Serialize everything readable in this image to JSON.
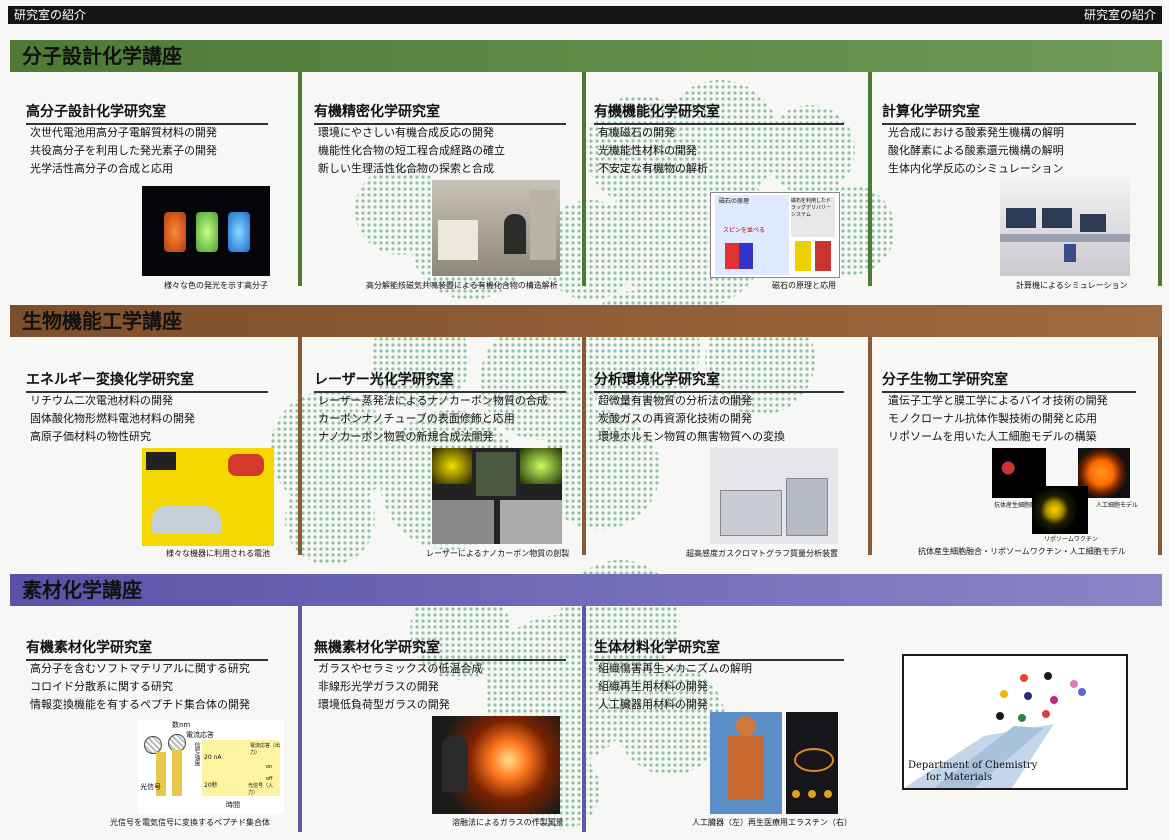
{
  "header": {
    "left": "研究室の紹介",
    "right": "研究室の紹介"
  },
  "sections": [
    {
      "title": "分子設計化学講座",
      "color": "#587d3a",
      "labs": [
        {
          "title": "高分子設計化学研究室",
          "items": [
            "次世代電池用高分子電解質材料の開発",
            "共役高分子を利用した発光素子の開発",
            "光学活性高分子の合成と応用"
          ],
          "caption": "様々な色の発光を示す高分子"
        },
        {
          "title": "有機精密化学研究室",
          "items": [
            "環境にやさしい有機合成反応の開発",
            "機能性化合物の短工程合成経路の確立",
            "新しい生理活性化合物の探索と合成"
          ],
          "caption": "高分解能核磁気共鳴装置による有機化合物の構造解析"
        },
        {
          "title": "有機機能化学研究室",
          "items": [
            "有機磁石の開発",
            "光機能性材料の開発",
            "不安定な有機物の解析"
          ],
          "caption": "磁石の原理と応用"
        },
        {
          "title": "計算化学研究室",
          "items": [
            "光合成における酸素発生機構の解明",
            "酸化酵素による酸素還元機構の解明",
            "生体内化学反応のシミュレーション"
          ],
          "caption": "計算機によるシミュレーション"
        }
      ]
    },
    {
      "title": "生物機能工学講座",
      "color": "#8a5a34",
      "labs": [
        {
          "title": "エネルギー変換化学研究室",
          "items": [
            "リチウム二次電池材料の開発",
            "固体酸化物形燃料電池材料の開発",
            "高原子価材料の物性研究"
          ],
          "caption": "様々な機器に利用される電池"
        },
        {
          "title": "レーザー光化学研究室",
          "items": [
            "レーザー蒸発法によるナノカーボン物質の合成",
            "カーボンナノチューブの表面修飾と応用",
            "ナノカーボン物質の新規合成法開発"
          ],
          "caption": "レーザーによるナノカーボン物質の創製"
        },
        {
          "title": "分析環境化学研究室",
          "items": [
            "超微量有害物質の分析法の開発",
            "炭酸ガスの再資源化技術の開発",
            "環境ホルモン物質の無害物質への変換"
          ],
          "caption": "超高感度ガスクロマトグラフ質量分析装置"
        },
        {
          "title": "分子生物工学研究室",
          "items": [
            "遺伝子工学と膜工学によるバイオ技術の開発",
            "モノクローナル抗体作製技術の開発と応用",
            "リポソームを用いた人工細胞モデルの構築"
          ],
          "caption": "抗体産生細胞融合・リポソームワクチン・人工細胞モデル"
        }
      ]
    },
    {
      "title": "素材化学講座",
      "color": "#5e59a8",
      "labs": [
        {
          "title": "有機素材化学研究室",
          "items": [
            "高分子を含むソフトマテリアルに関する研究",
            "コロイド分散系に関する研究",
            "情報変換機能を有するペプチド集合体の開発"
          ],
          "caption": "光信号を電気信号に変換するペプチド集合体"
        },
        {
          "title": "無機素材化学研究室",
          "items": [
            "ガラスやセラミックスの低温合成",
            "非線形光学ガラスの開発",
            "環境低負荷型ガラスの開発"
          ],
          "caption": "溶融法によるガラスの作製風景"
        },
        {
          "title": "生体材料化学研究室",
          "items": [
            "組織傷害再生メカニズムの解明",
            "組織再生用材料の開発",
            "人工臓器用材料の開発"
          ],
          "caption": "人工臓器（左）再生医療用エラスチン（右）"
        }
      ]
    }
  ],
  "photo_labels": {
    "magnet_title": "磁石の原理",
    "magnet_sub": "スピンを並べる",
    "magnet_apply": "磁石を利用したドラッグデリバリーシステム",
    "bio_a": "抗体産生細胞融合",
    "bio_b": "人工細胞モデル",
    "bio_c": "リポソームワクチン",
    "peptide_top": "数nm",
    "peptide_resp": "電流応答",
    "peptide_light": "光信号",
    "peptide_time": "時間",
    "peptide_na": "20 nA",
    "peptide_sec": "20秒",
    "peptide_on": "on",
    "peptide_off": "off",
    "peptide_current": "電流応答（出力）",
    "peptide_signal": "光信号（入力）",
    "peptide_axis": "信号強度"
  },
  "logo": {
    "line1": "Department of Chemistry",
    "line2": "for Materials"
  }
}
